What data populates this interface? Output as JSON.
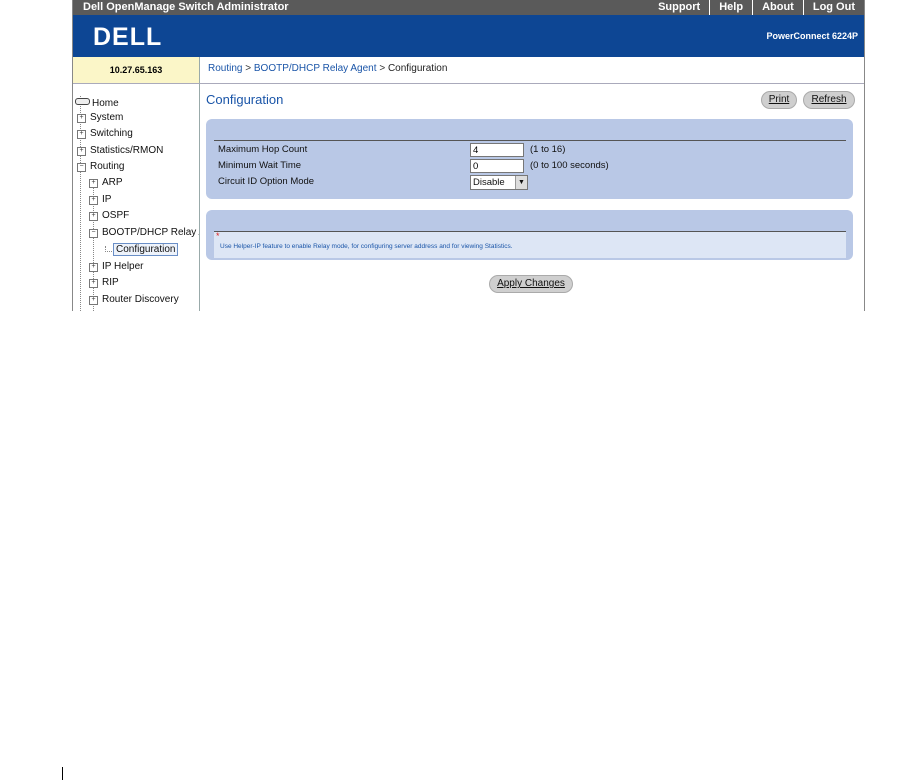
{
  "topbar": {
    "app_title": "Dell OpenManage Switch Administrator",
    "links": [
      "Support",
      "Help",
      "About",
      "Log Out"
    ]
  },
  "banner": {
    "logo_text": "DELL",
    "model": "PowerConnect 6224P"
  },
  "ip_address": "10.27.65.163",
  "breadcrumb": {
    "items": [
      "Routing",
      "BOOTP/DHCP Relay Agent"
    ],
    "separator": ">",
    "current": "Configuration"
  },
  "nav": {
    "home": "Home",
    "system": "System",
    "switching": "Switching",
    "statistics": "Statistics/RMON",
    "routing": "Routing",
    "arp": "ARP",
    "ip": "IP",
    "ospf": "OSPF",
    "bootp": "BOOTP/DHCP Relay A",
    "configuration": "Configuration",
    "ip_helper": "IP Helper",
    "rip": "RIP",
    "router_discovery": "Router Discovery",
    "expand_glyph": "+",
    "collapse_glyph": "−"
  },
  "page": {
    "title": "Configuration",
    "print_label": "Print",
    "refresh_label": "Refresh"
  },
  "form": {
    "max_hop_label": "Maximum Hop Count",
    "max_hop_value": "4",
    "max_hop_range": "(1 to 16)",
    "min_wait_label": "Minimum Wait Time",
    "min_wait_value": "0",
    "min_wait_range": "(0 to 100 seconds)",
    "circuit_label": "Circuit ID Option Mode",
    "circuit_value": "Disable"
  },
  "note": {
    "asterisk": "*",
    "text": "Use Helper-IP feature to enable Relay mode, for configuring server address and for viewing Statistics."
  },
  "apply_label": "Apply Changes",
  "colors": {
    "banner": "#0d4694",
    "panel": "#b9c8e6",
    "link": "#1a55a8"
  }
}
